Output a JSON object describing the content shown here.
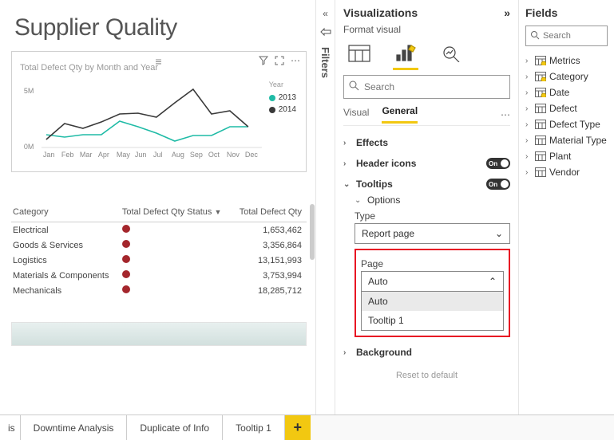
{
  "page_title": "Supplier Quality",
  "filters_label": "Filters",
  "chart_data": {
    "type": "line",
    "title": "Total Defect Qty by Month and Year",
    "categories": [
      "Jan",
      "Feb",
      "Mar",
      "Apr",
      "May",
      "Jun",
      "Jul",
      "Aug",
      "Sep",
      "Oct",
      "Nov",
      "Dec"
    ],
    "series": [
      {
        "name": "2013",
        "color": "#1fbba6",
        "values": [
          1.3,
          1.1,
          1.3,
          1.3,
          2.5,
          2.0,
          1.4,
          0.7,
          1.2,
          1.2,
          2.0,
          2.0
        ]
      },
      {
        "name": "2014",
        "color": "#3a3a3a",
        "values": [
          0.9,
          2.2,
          1.8,
          2.3,
          3.0,
          3.1,
          2.7,
          4.0,
          5.2,
          3.0,
          3.3,
          2.0
        ]
      }
    ],
    "ylabel": "",
    "yticks": [
      "5M",
      "0M"
    ],
    "ylim": [
      0,
      6
    ],
    "legend_title": "Year"
  },
  "table": {
    "columns": [
      "Category",
      "Total Defect Qty Status",
      "Total Defect Qty"
    ],
    "rows": [
      {
        "cat": "Electrical",
        "qty": "1,653,462"
      },
      {
        "cat": "Goods & Services",
        "qty": "3,356,864"
      },
      {
        "cat": "Logistics",
        "qty": "13,151,993"
      },
      {
        "cat": "Materials & Components",
        "qty": "3,753,994"
      },
      {
        "cat": "Mechanicals",
        "qty": "18,285,712"
      }
    ]
  },
  "viz_panel": {
    "title": "Visualizations",
    "subtitle": "Format visual",
    "search_placeholder": "Search",
    "tabs": {
      "visual": "Visual",
      "general": "General"
    },
    "sections": {
      "effects": "Effects",
      "header_icons": "Header icons",
      "tooltips": "Tooltips",
      "options": "Options",
      "background": "Background"
    },
    "toggle_on": "On",
    "type_label": "Type",
    "type_value": "Report page",
    "page_label": "Page",
    "page_value": "Auto",
    "page_options": [
      "Auto",
      "Tooltip 1"
    ],
    "reset": "Reset to default"
  },
  "fields_panel": {
    "title": "Fields",
    "search_placeholder": "Search",
    "tables": [
      {
        "name": "Metrics",
        "checked": true
      },
      {
        "name": "Category",
        "checked": true
      },
      {
        "name": "Date",
        "checked": true
      },
      {
        "name": "Defect",
        "checked": false
      },
      {
        "name": "Defect Type",
        "checked": false
      },
      {
        "name": "Material Type",
        "checked": false
      },
      {
        "name": "Plant",
        "checked": false
      },
      {
        "name": "Vendor",
        "checked": false
      }
    ]
  },
  "pages": {
    "partial": "is",
    "tabs": [
      "Downtime Analysis",
      "Duplicate of Info",
      "Tooltip 1"
    ]
  }
}
